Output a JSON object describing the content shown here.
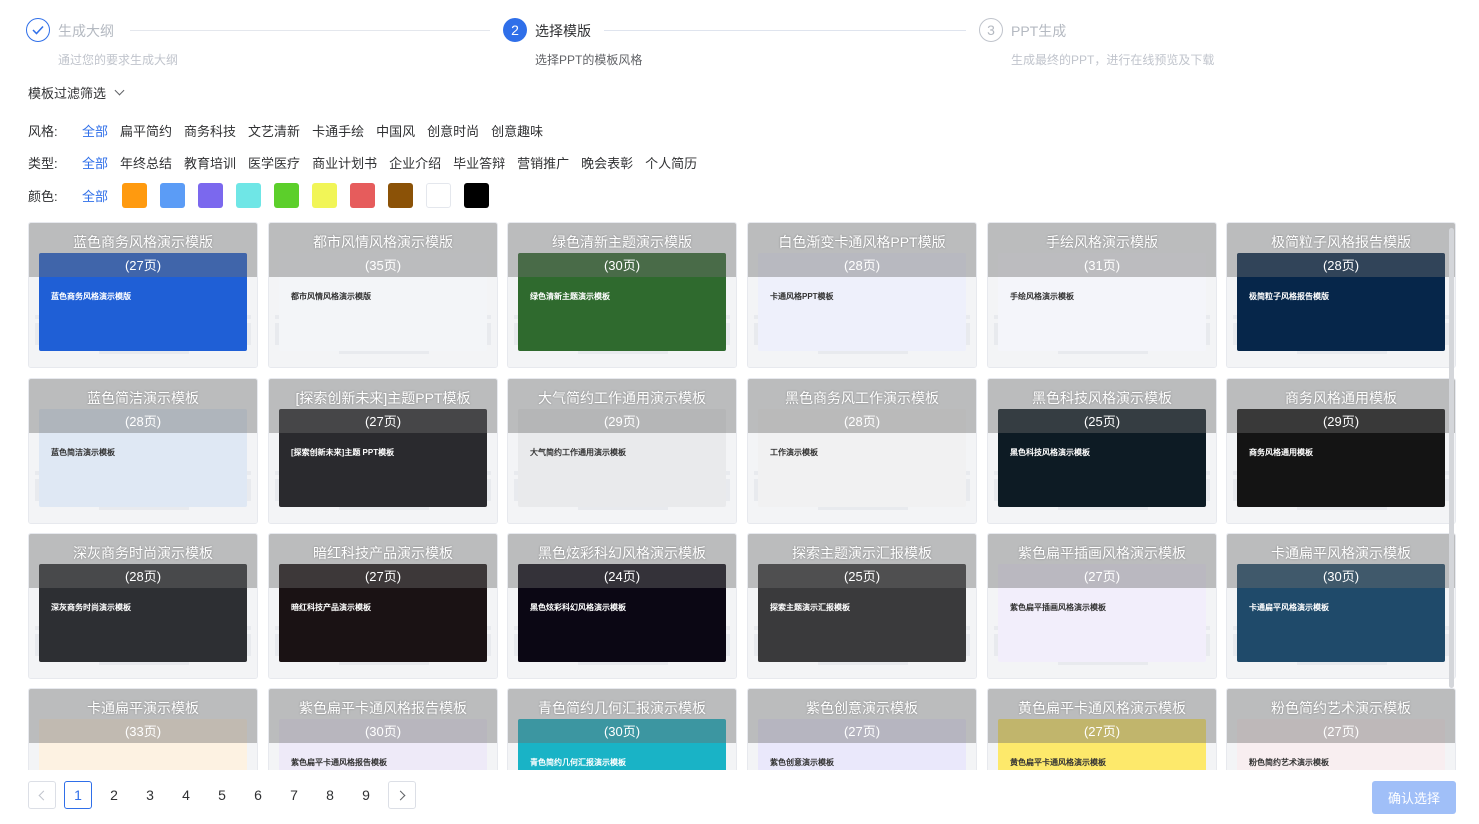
{
  "steps": [
    {
      "index": "",
      "title": "生成大纲",
      "desc": "通过您的要求生成大纲",
      "state": "done"
    },
    {
      "index": "2",
      "title": "选择模版",
      "desc": "选择PPT的模板风格",
      "state": "active"
    },
    {
      "index": "3",
      "title": "PPT生成",
      "desc": "生成最终的PPT，进行在线预览及下载",
      "state": "todo"
    }
  ],
  "filter": {
    "toggle_label": "模板过滤筛选",
    "style_label": "风格:",
    "style_options": [
      "全部",
      "扁平简约",
      "商务科技",
      "文艺清新",
      "卡通手绘",
      "中国风",
      "创意时尚",
      "创意趣味"
    ],
    "type_label": "类型:",
    "type_options": [
      "全部",
      "年终总结",
      "教育培训",
      "医学医疗",
      "商业计划书",
      "企业介绍",
      "毕业答辩",
      "营销推广",
      "晚会表彰",
      "个人简历"
    ],
    "color_label": "颜色:",
    "color_all": "全部",
    "colors": [
      "#ff9a0f",
      "#5b9cf6",
      "#7b68ee",
      "#6fe6e6",
      "#5ccf2b",
      "#f1f557",
      "#e65c5c",
      "#8b5207",
      "#ffffff",
      "#000000"
    ]
  },
  "templates": [
    {
      "name": "蓝色商务风格演示模版",
      "pages": "(27页)",
      "color": "#1f5fd6",
      "inner": "蓝色商务风格演示模版"
    },
    {
      "name": "都市风情风格演示模版",
      "pages": "(35页)",
      "color": "#f3f5f8",
      "inner": "都市风情风格演示模版"
    },
    {
      "name": "绿色清新主题演示模版",
      "pages": "(30页)",
      "color": "#2f6a2e",
      "inner": "绿色清新主题演示模板"
    },
    {
      "name": "白色渐变卡通风格PPT模版",
      "pages": "(28页)",
      "color": "#eef0fb",
      "inner": "卡通风格PPT模板"
    },
    {
      "name": "手绘风格演示模版",
      "pages": "(31页)",
      "color": "#f4f5fa",
      "inner": "手绘风格演示模板"
    },
    {
      "name": "极简粒子风格报告模版",
      "pages": "(28页)",
      "color": "#06264a",
      "inner": "极简粒子风格报告模版"
    },
    {
      "name": "蓝色简洁演示模板",
      "pages": "(28页)",
      "color": "#dfe8f4",
      "inner": "蓝色简洁演示模板"
    },
    {
      "name": "[探索创新未来]主题PPT模板",
      "pages": "(27页)",
      "color": "#2a2a2e",
      "inner": "[探索创新未来]主题 PPT模板"
    },
    {
      "name": "大气简约工作通用演示模板",
      "pages": "(29页)",
      "color": "#e9eaec",
      "inner": "大气简约工作通用演示模板"
    },
    {
      "name": "黑色商务风工作演示模板",
      "pages": "(28页)",
      "color": "#f1f1f2",
      "inner": "工作演示模板"
    },
    {
      "name": "黑色科技风格演示模板",
      "pages": "(25页)",
      "color": "#0d1b24",
      "inner": "黑色科技风格演示模板"
    },
    {
      "name": "商务风格通用模板",
      "pages": "(29页)",
      "color": "#141414",
      "inner": "商务风格通用模板"
    },
    {
      "name": "深灰商务时尚演示模板",
      "pages": "(28页)",
      "color": "#2d2f33",
      "inner": "深灰商务时尚演示模板"
    },
    {
      "name": "暗红科技产品演示模板",
      "pages": "(27页)",
      "color": "#1a1214",
      "inner": "暗红科技产品演示模板"
    },
    {
      "name": "黑色炫彩科幻风格演示模板",
      "pages": "(24页)",
      "color": "#0b0714",
      "inner": "黑色炫彩科幻风格演示模板"
    },
    {
      "name": "探索主题演示汇报模板",
      "pages": "(25页)",
      "color": "#3a3a3c",
      "inner": "探索主题演示汇报模板"
    },
    {
      "name": "紫色扁平插画风格演示模板",
      "pages": "(27页)",
      "color": "#f2eefb",
      "inner": "紫色扁平插画风格演示模板"
    },
    {
      "name": "卡通扁平风格演示模板",
      "pages": "(30页)",
      "color": "#1f4a6a",
      "inner": "卡通扁平风格演示模板"
    },
    {
      "name": "卡通扁平演示模板",
      "pages": "(33页)",
      "color": "#fdf2e2",
      "inner": ""
    },
    {
      "name": "紫色扁平卡通风格报告模板",
      "pages": "(30页)",
      "color": "#eeeaf8",
      "inner": "紫色扁平卡通风格报告模板"
    },
    {
      "name": "青色简约几何汇报演示模板",
      "pages": "(30页)",
      "color": "#19b3c6",
      "inner": "青色简约几何汇报演示模板"
    },
    {
      "name": "紫色创意演示模板",
      "pages": "(27页)",
      "color": "#eae8fb",
      "inner": "紫色创意演示模板"
    },
    {
      "name": "黄色扁平卡通风格演示模板",
      "pages": "(27页)",
      "color": "#fde96b",
      "inner": "黄色扁平卡通风格演示模板"
    },
    {
      "name": "粉色简约艺术演示模板",
      "pages": "(27页)",
      "color": "#f8eef0",
      "inner": "粉色简约艺术演示模板"
    }
  ],
  "pagination": {
    "pages": [
      "1",
      "2",
      "3",
      "4",
      "5",
      "6",
      "7",
      "8",
      "9"
    ],
    "current": "1"
  },
  "confirm_label": "确认选择",
  "accent": "#2f6fe9"
}
